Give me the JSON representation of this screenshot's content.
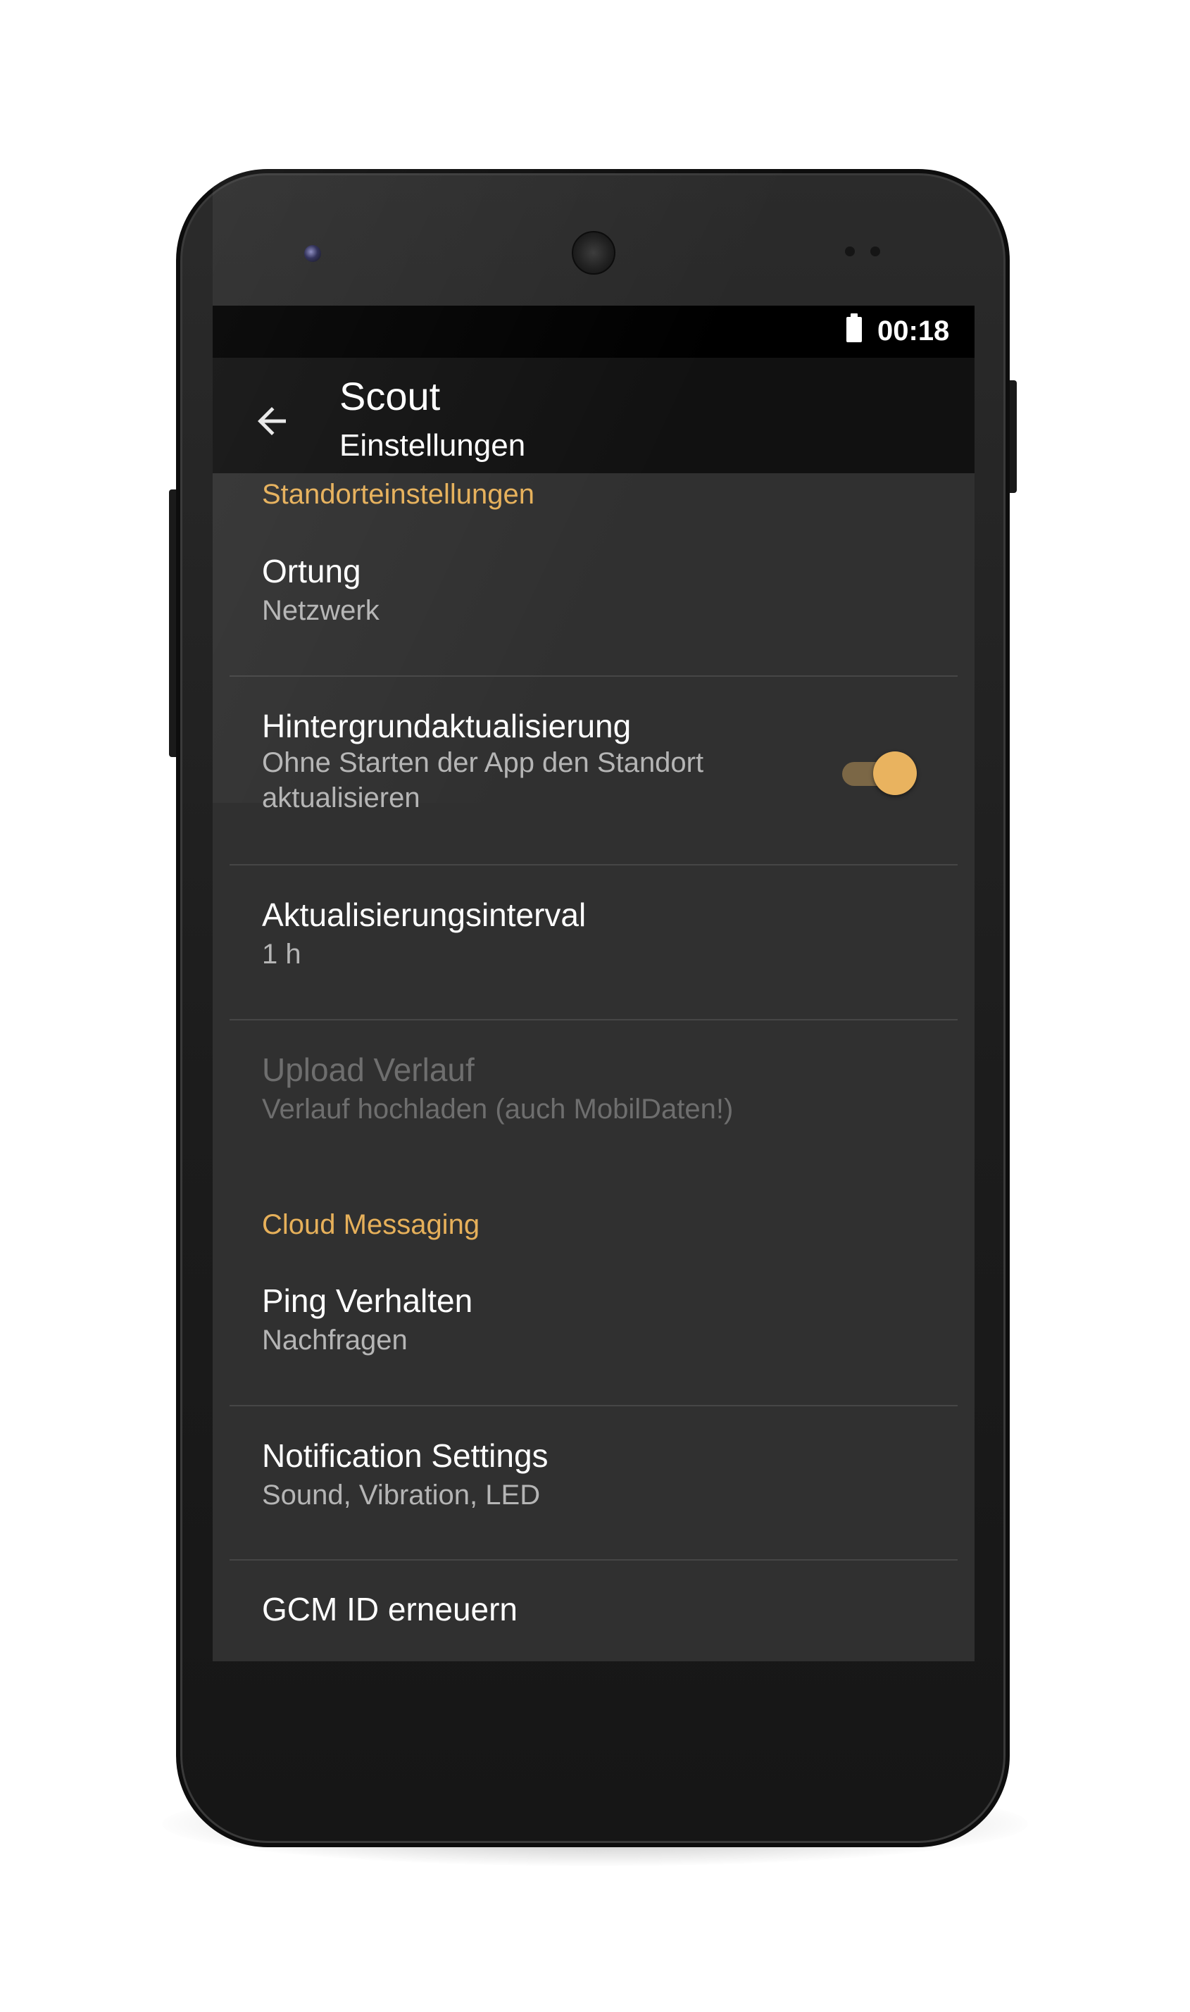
{
  "status_bar": {
    "time": "00:18",
    "battery_icon": "battery-full-icon"
  },
  "app_bar": {
    "title": "Scout",
    "subtitle": "Einstellungen",
    "back_icon": "arrow-back-icon"
  },
  "sections": [
    {
      "header": "Standorteinstellungen",
      "items": [
        {
          "title": "Ortung",
          "subtitle": "Netzwerk"
        },
        {
          "title": "Hintergrundaktualisierung",
          "subtitle_line1": "Ohne Starten der App den Standort",
          "subtitle_line2": "aktualisieren",
          "toggle_on": true
        },
        {
          "title": "Aktualisierungsinterval",
          "subtitle": "1 h"
        },
        {
          "title": "Upload Verlauf",
          "subtitle": "Verlauf hochladen (auch MobilDaten!)",
          "enabled": false
        }
      ]
    },
    {
      "header": "Cloud Messaging",
      "items": [
        {
          "title": "Ping Verhalten",
          "subtitle": "Nachfragen"
        },
        {
          "title": "Notification Settings",
          "subtitle": "Sound, Vibration, LED"
        },
        {
          "title": "GCM ID erneuern"
        }
      ]
    }
  ],
  "colors": {
    "accent": "#e6b05a",
    "background": "#303030",
    "app_bar": "#111111",
    "status_bar": "#000000"
  }
}
